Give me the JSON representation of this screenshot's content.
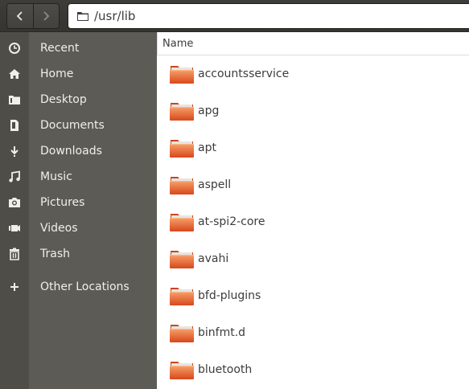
{
  "header": {
    "back_icon": "chevron-left-icon",
    "forward_icon": "chevron-right-icon",
    "path": "/usr/lib"
  },
  "sidebar": {
    "items": [
      {
        "label": "Recent",
        "icon": "clock-icon"
      },
      {
        "label": "Home",
        "icon": "home-icon"
      },
      {
        "label": "Desktop",
        "icon": "desktop-icon"
      },
      {
        "label": "Documents",
        "icon": "document-icon"
      },
      {
        "label": "Downloads",
        "icon": "download-icon"
      },
      {
        "label": "Music",
        "icon": "music-icon"
      },
      {
        "label": "Pictures",
        "icon": "camera-icon"
      },
      {
        "label": "Videos",
        "icon": "video-icon"
      },
      {
        "label": "Trash",
        "icon": "trash-icon"
      },
      {
        "label": "Other Locations",
        "icon": "plus-icon"
      }
    ]
  },
  "list": {
    "column_name": "Name",
    "files": [
      {
        "name": "accountsservice"
      },
      {
        "name": "apg"
      },
      {
        "name": "apt"
      },
      {
        "name": "aspell"
      },
      {
        "name": "at-spi2-core"
      },
      {
        "name": "avahi"
      },
      {
        "name": "bfd-plugins"
      },
      {
        "name": "binfmt.d"
      },
      {
        "name": "bluetooth"
      }
    ]
  },
  "colors": {
    "folder_top": "#f58b4c",
    "folder_bottom": "#d8481c",
    "sidebar_bg": "#5c5b56",
    "header_bg": "#3e3d39"
  }
}
